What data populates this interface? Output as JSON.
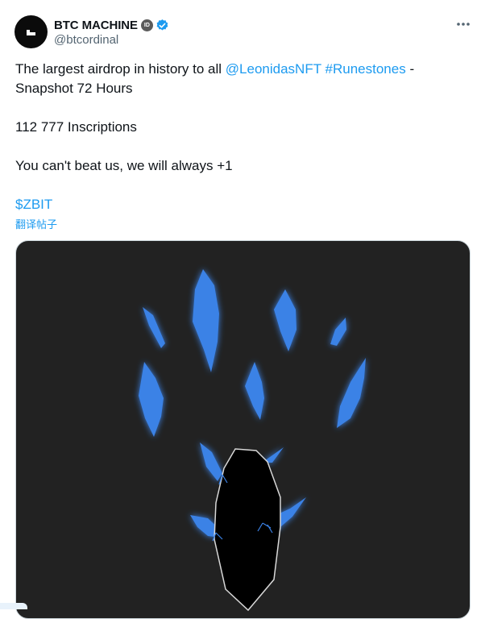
{
  "author": {
    "display_name": "BTC MACHINE",
    "id_badge": "ID",
    "handle": "@btcordinal",
    "avatar_icon": "btc-machine-logo"
  },
  "post": {
    "line1_prefix": "The largest airdrop in history to all ",
    "mention": "@LeonidasNFT",
    "hashtag": "#Runestones",
    "line1_suffix": " -",
    "line2": "Snapshot 72 Hours",
    "line3": "112 777 Inscriptions",
    "line4": "You can't beat us, we will always +1",
    "cashtag": "$ZBIT",
    "translate": "翻译帖子"
  },
  "colors": {
    "link": "#1d9bf0",
    "media_bg": "#222222",
    "shard": "#3b82e6",
    "verified": "#1d9bf0"
  }
}
